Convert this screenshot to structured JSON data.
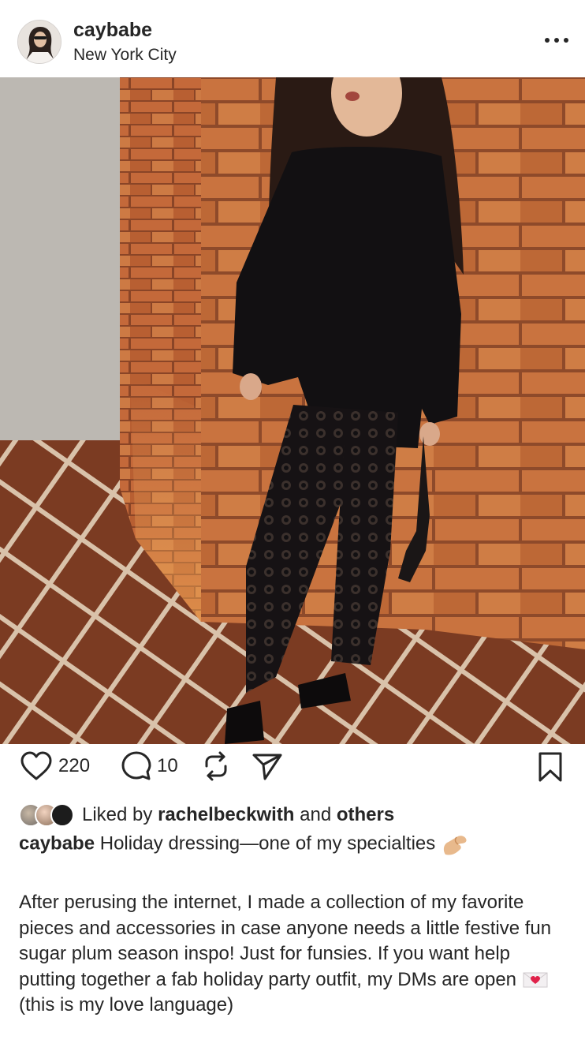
{
  "post": {
    "username": "caybabe",
    "location": "New York City",
    "more_icon": "more-horizontal-icon"
  },
  "actions": {
    "likes_count": "220",
    "comments_count": "10"
  },
  "liked_by": {
    "prefix": "Liked by",
    "user": "rachelbeckwith",
    "and": "and",
    "others": "others"
  },
  "caption": {
    "username": "caybabe",
    "text": "Holiday dressing—one of my specialties"
  },
  "body": {
    "part1": "After perusing the internet, I made a collection of my favorite pieces and accessories in case anyone needs a little festive fun sugar plum season inspo! Just for funsies. If you want help putting together a fab holiday party outfit, my DMs are open",
    "part2": "(this is my love language)"
  },
  "colors": {
    "text": "#262626",
    "brick": "#c8703c",
    "floor": "#7a3a22"
  }
}
